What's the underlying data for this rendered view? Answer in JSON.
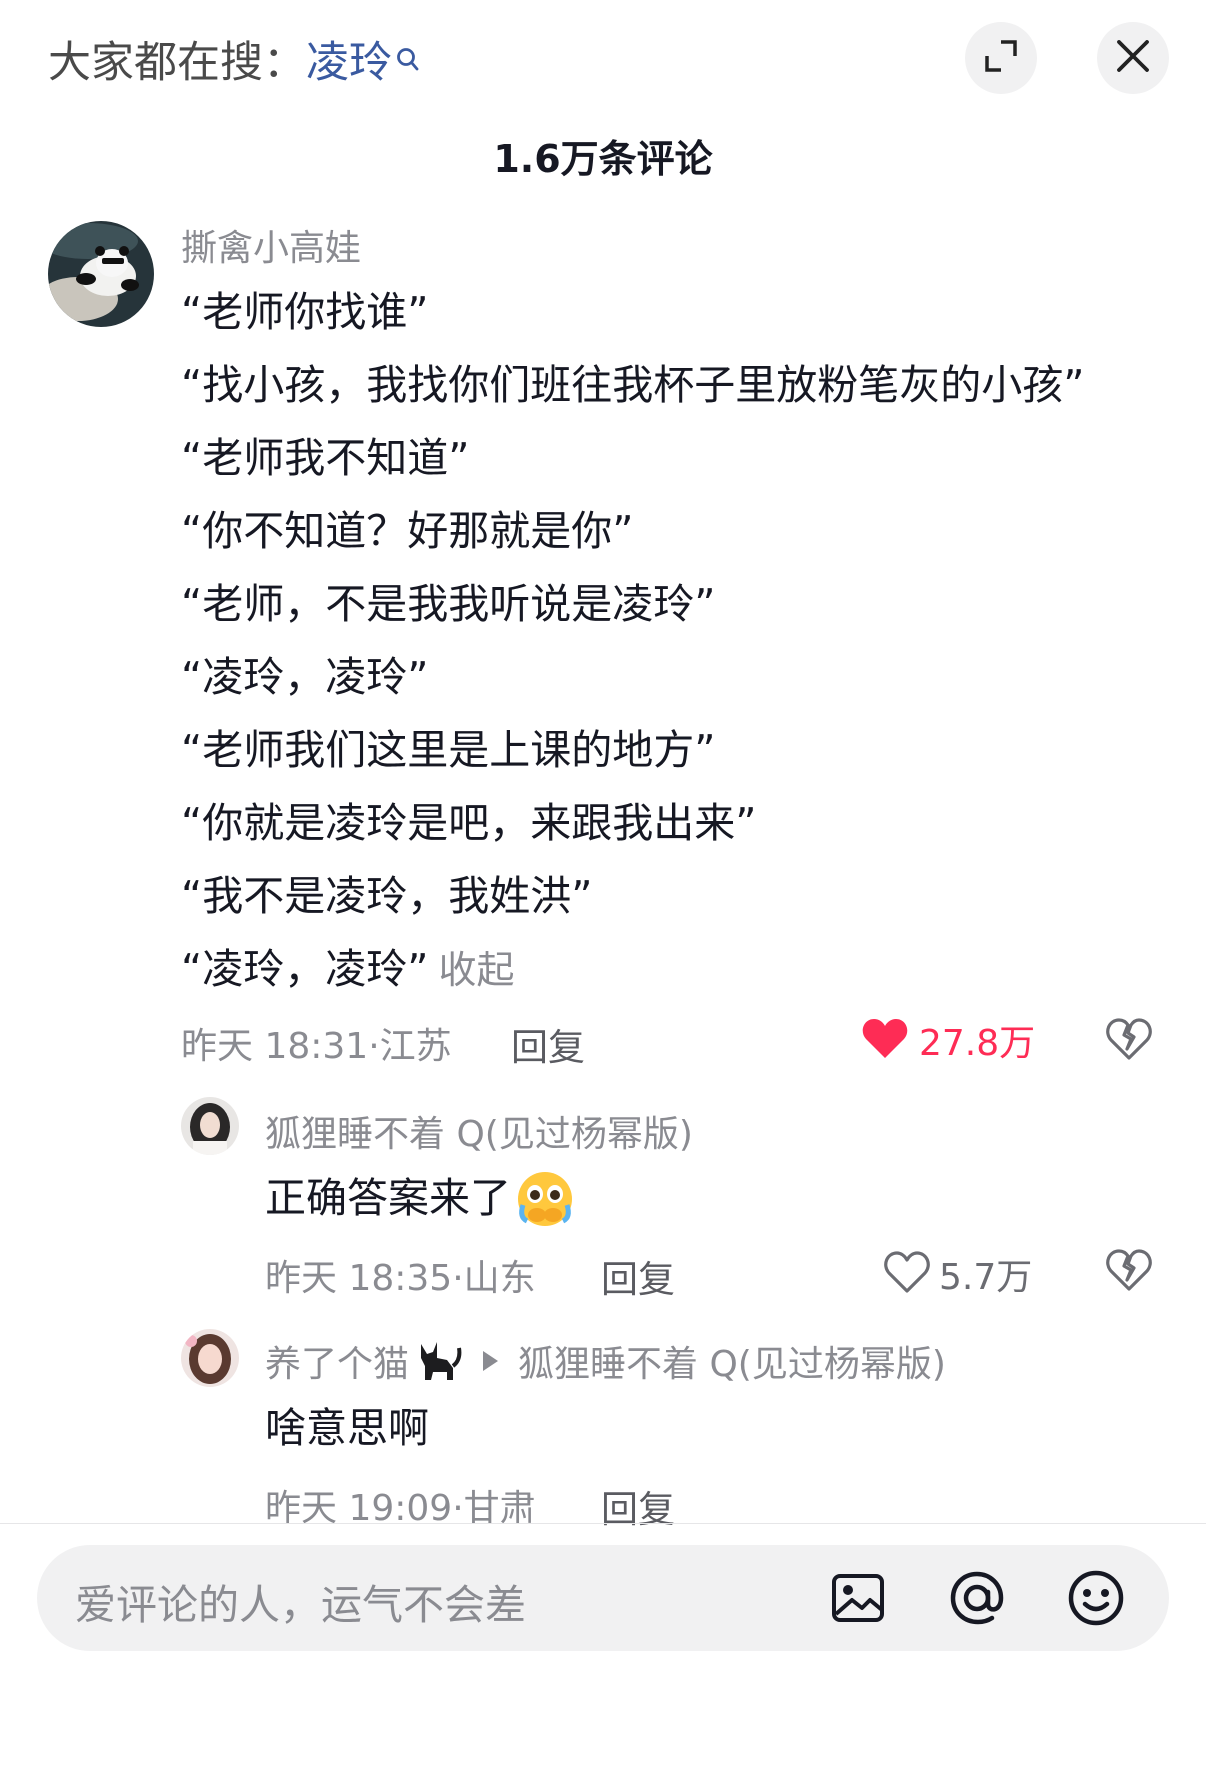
{
  "header": {
    "search_prefix": "大家都在搜：",
    "search_keyword": "凌玲",
    "icons": {
      "search": "search-icon",
      "expand": "expand-icon",
      "close": "close-icon"
    }
  },
  "comment_count_title": "1.6万条评论",
  "comments": [
    {
      "username": "撕禽小高娃",
      "avatar_icon": "panda-avatar",
      "lines": [
        "“老师你找谁”",
        "“找小孩，我找你们班往我杯子里放粉笔灰的小孩”",
        "“老师我不知道”",
        "“你不知道？好那就是你”",
        "“老师，不是我我听说是凌玲”",
        "“凌玲，凌玲”",
        "“老师我们这里是上课的地方”",
        "“你就是凌玲是吧，来跟我出来”",
        "“我不是凌玲，我姓洪”",
        "“凌玲，凌玲”"
      ],
      "collapse_label": "收起",
      "time": "昨天 18:31",
      "location": "江苏",
      "reply_label": "回复",
      "likes": "27.8万",
      "liked": true,
      "like_color": "#fe2c55"
    },
    {
      "username": "狐狸睡不着 Q(见过杨幂版)",
      "avatar_icon": "girl-avatar",
      "text": "正确答案来了",
      "emoji": "crying-face-emoji",
      "time": "昨天 18:35",
      "location": "山东",
      "reply_label": "回复",
      "likes": "5.7万",
      "liked": false
    },
    {
      "username": "养了个猫",
      "username_icon": "black-cat-emoji",
      "reply_to": "狐狸睡不着 Q(见过杨幂版)",
      "avatar_icon": "girl-avatar-2",
      "text": "啥意思啊",
      "time": "昨天 19:09",
      "location": "甘肃",
      "reply_label": "回复"
    }
  ],
  "input_bar": {
    "placeholder": "爱评论的人，运气不会差",
    "icons": [
      "image-icon",
      "at-icon",
      "emoji-icon"
    ]
  }
}
